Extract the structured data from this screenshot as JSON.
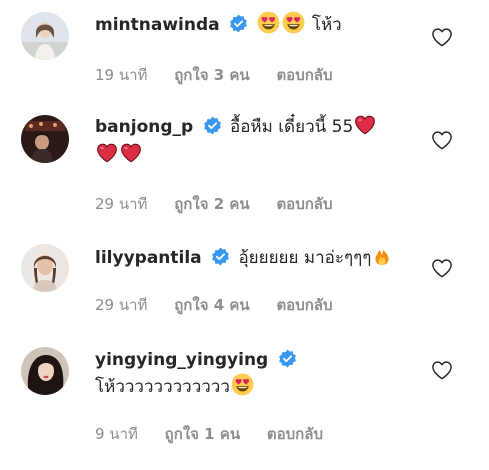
{
  "colors": {
    "text": "#262626",
    "meta": "#8e8e8e",
    "verified": "#3897f0",
    "emoji_red": "#e0245e"
  },
  "comments": [
    {
      "username": "mintnawinda",
      "verified": true,
      "text_after_emoji": "โห้ว",
      "emojis": [
        "heart-eyes-emoji",
        "heart-eyes-emoji"
      ],
      "time": "19 นาที",
      "likes": "ถูกใจ 3 คน",
      "reply": "ตอบกลับ"
    },
    {
      "username": "banjong_p",
      "verified": true,
      "text": "อื้อหืม เดี๋ยวนี้ 55",
      "emojis": [
        "red-heart-emoji",
        "red-heart-emoji",
        "red-heart-emoji"
      ],
      "time": "29 นาที",
      "likes": "ถูกใจ 2 คน",
      "reply": "ตอบกลับ"
    },
    {
      "username": "lilyypantila",
      "verified": true,
      "text": "อุ้ยยยยย มาอ่ะๆๆๆ",
      "emojis": [
        "fire-emoji"
      ],
      "time": "29 นาที",
      "likes": "ถูกใจ 4 คน",
      "reply": "ตอบกลับ"
    },
    {
      "username": "yingying_yingying",
      "verified": true,
      "text": "โห้วววววววววววว",
      "emojis": [
        "heart-eyes-emoji"
      ],
      "time": "9 นาที",
      "likes": "ถูกใจ 1 คน",
      "reply": "ตอบกลับ"
    }
  ]
}
